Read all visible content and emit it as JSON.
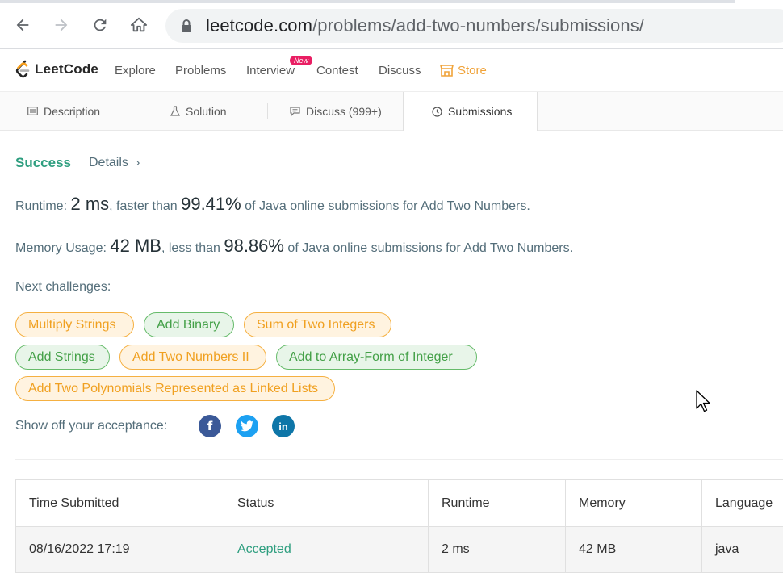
{
  "browser": {
    "url_host": "leetcode.com",
    "url_path": "/problems/add-two-numbers/submissions/"
  },
  "header": {
    "brand": "LeetCode",
    "nav": [
      "Explore",
      "Problems",
      "Interview",
      "Contest",
      "Discuss"
    ],
    "badge_new": "New",
    "store": "Store"
  },
  "tabs": {
    "description": "Description",
    "solution": "Solution",
    "discuss": "Discuss (999+)",
    "submissions": "Submissions"
  },
  "result": {
    "status": "Success",
    "details": "Details",
    "runtime_label": "Runtime: ",
    "runtime_value": "2 ms",
    "runtime_mid": ", faster than ",
    "runtime_pct": "99.41%",
    "runtime_tail": " of Java online submissions for Add Two Numbers.",
    "memory_label": "Memory Usage: ",
    "memory_value": "42 MB",
    "memory_mid": ", less than ",
    "memory_pct": "98.86%",
    "memory_tail": " of Java online submissions for Add Two Numbers."
  },
  "challenges": {
    "label": "Next challenges:",
    "items": [
      "Multiply Strings",
      "Add Binary",
      "Sum of Two Integers",
      "Add Strings",
      "Add Two Numbers II",
      "Add to Array-Form of Integer",
      "Add Two Polynomials Represented as Linked Lists"
    ]
  },
  "share": {
    "label": "Show off your acceptance:",
    "facebook_glyph": "f",
    "linkedin_glyph": "in"
  },
  "table": {
    "headers": [
      "Time Submitted",
      "Status",
      "Runtime",
      "Memory",
      "Language"
    ],
    "rows": [
      [
        "08/16/2022 17:19",
        "Accepted",
        "2 ms",
        "42 MB",
        "java"
      ]
    ]
  },
  "colors": {
    "accent_green": "#2e9e7f",
    "chip_orange": "#f0a020",
    "chip_green": "#43a047",
    "store": "#f0a33a",
    "facebook": "#3b5998",
    "twitter": "#1da1f2",
    "linkedin": "#0e76a8"
  }
}
